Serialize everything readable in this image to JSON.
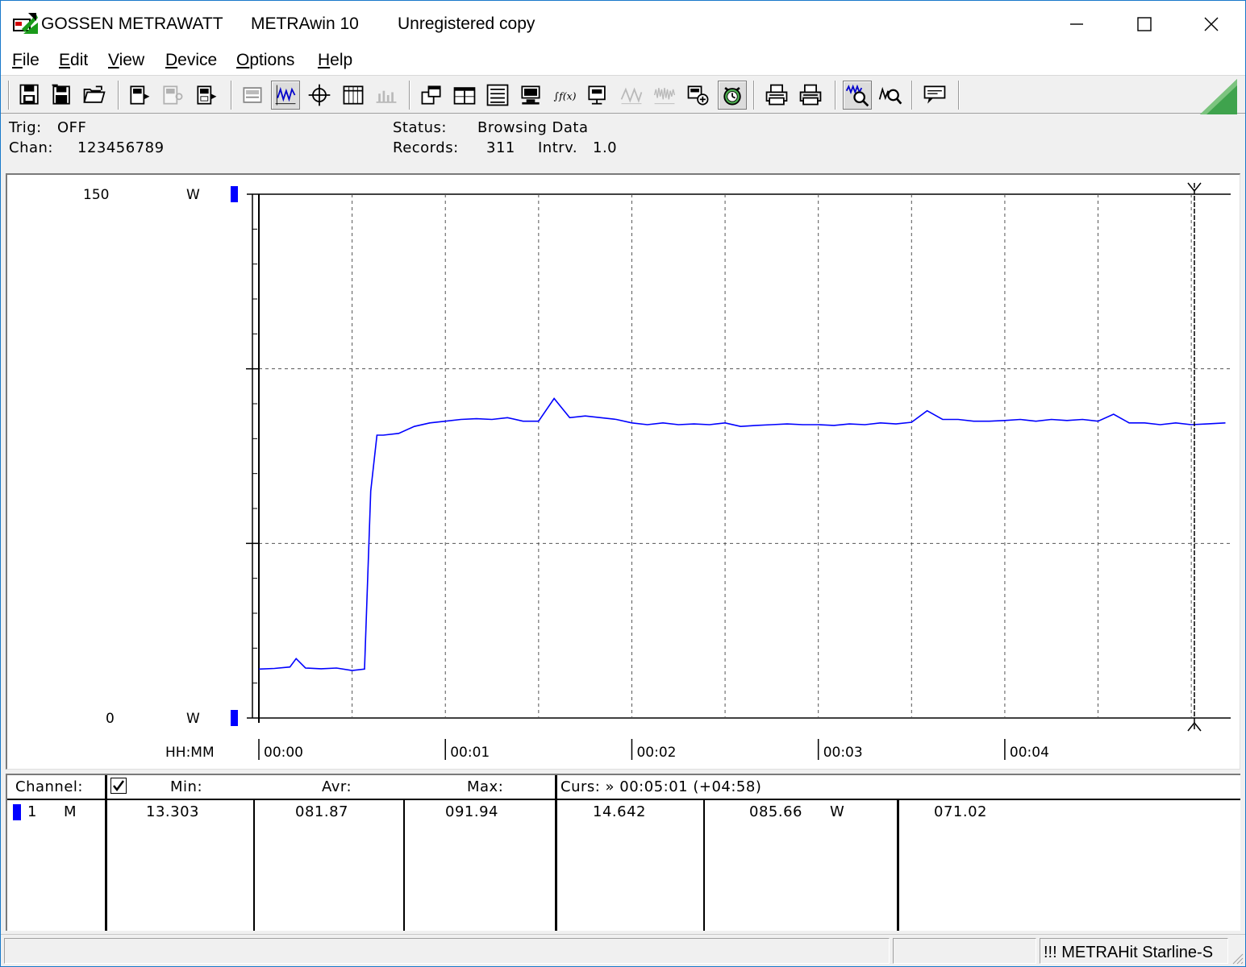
{
  "titlebar": {
    "brand": "GOSSEN METRAWATT",
    "app": "METRAwin 10",
    "license": "Unregistered copy"
  },
  "menu": [
    {
      "label": "File",
      "key": "F",
      "rest": "ile"
    },
    {
      "label": "Edit",
      "key": "E",
      "rest": "dit"
    },
    {
      "label": "View",
      "key": "V",
      "rest": "iew"
    },
    {
      "label": "Device",
      "key": "D",
      "rest": "evice"
    },
    {
      "label": "Options",
      "key": "O",
      "rest": "ptions"
    },
    {
      "label": "Help",
      "key": "H",
      "rest": "elp"
    }
  ],
  "toolbar": {
    "buttons": [
      "save-file-icon",
      "save-as-icon",
      "open-file-icon",
      "device-read-icon",
      "device-config-icon",
      "device-memory-icon",
      "print-preview-icon",
      "wave-view-icon",
      "crosshair-icon",
      "table-view-icon",
      "bar-view-icon",
      "window-move-icon",
      "window-split-icon",
      "list-data-icon",
      "monitor-icon",
      "function-icon",
      "display-icon",
      "wave-signal-icon",
      "noise-signal-icon",
      "record-icon",
      "alarm-clock-icon",
      "printer-icon",
      "printer-color-icon",
      "zoom-wave-icon",
      "zoom-cursor-icon",
      "comment-icon"
    ],
    "pressed": [
      "wave-view-icon",
      "alarm-clock-icon",
      "zoom-wave-icon"
    ],
    "disabled": [
      "device-config-icon",
      "bar-view-icon",
      "wave-signal-icon",
      "noise-signal-icon"
    ]
  },
  "status": {
    "trig_label": "Trig:",
    "trig_value": "OFF",
    "chan_label": "Chan:",
    "chan_value": "123456789",
    "status_label": "Status:",
    "status_value": "Browsing Data",
    "records_label": "Records:",
    "records_value": "311",
    "interval_label": "Intrv.",
    "interval_value": "1.0"
  },
  "chart_data": {
    "type": "line",
    "y_top_label": "150",
    "y_bottom_label": "0",
    "y_unit": "W",
    "ylim": [
      0,
      150
    ],
    "x_axis_label": "HH:MM",
    "x_ticks": [
      "00:00",
      "00:01",
      "00:02",
      "00:03",
      "00:04"
    ],
    "xlim_seconds": [
      0,
      311
    ],
    "cursor_seconds": 301,
    "line_color": "#0000ff",
    "series": [
      {
        "x": [
          0,
          5,
          10,
          12,
          15,
          20,
          25,
          30,
          34,
          36,
          38,
          40,
          45,
          50,
          55,
          60,
          65,
          70,
          75,
          80,
          85,
          90,
          95,
          100,
          105,
          110,
          115,
          120,
          125,
          130,
          135,
          140,
          145,
          150,
          155,
          160,
          165,
          170,
          175,
          180,
          185,
          190,
          195,
          200,
          205,
          210,
          215,
          220,
          225,
          230,
          235,
          240,
          245,
          250,
          255,
          260,
          265,
          270,
          275,
          280,
          285,
          290,
          295,
          300,
          305,
          311
        ],
        "y": [
          14.0,
          14.2,
          14.6,
          17.0,
          14.3,
          14.1,
          14.3,
          13.6,
          14.0,
          65.0,
          81.0,
          81.0,
          81.5,
          83.5,
          84.5,
          85.0,
          85.5,
          85.7,
          85.5,
          86.0,
          85.0,
          85.0,
          91.5,
          86.0,
          86.5,
          86.0,
          85.5,
          84.5,
          84.0,
          84.5,
          84.0,
          84.2,
          84.0,
          84.5,
          83.5,
          83.8,
          84.0,
          84.2,
          84.0,
          84.0,
          83.8,
          84.2,
          84.0,
          84.5,
          84.2,
          84.7,
          88.0,
          85.5,
          85.5,
          85.0,
          85.0,
          85.2,
          85.5,
          85.0,
          85.5,
          85.2,
          85.5,
          85.0,
          87.0,
          84.5,
          84.5,
          84.0,
          84.5,
          84.0,
          84.2,
          84.5
        ]
      }
    ]
  },
  "table": {
    "headers": {
      "channel": "Channel:",
      "min": "Min:",
      "avr": "Avr:",
      "max": "Max:",
      "curs": "Curs: » 00:05:01 (+04:58)"
    },
    "channel_checked": true,
    "rows": [
      {
        "channel": "1",
        "mode": "M",
        "min": "13.303",
        "avr": "081.87",
        "max": "091.94",
        "curs_left": "14.642",
        "curs_value": "085.66",
        "unit": "W",
        "curs_right": "071.02",
        "color": "#0000ff"
      }
    ]
  },
  "statusbar": {
    "device": "!!! METRAHit Starline-S"
  }
}
